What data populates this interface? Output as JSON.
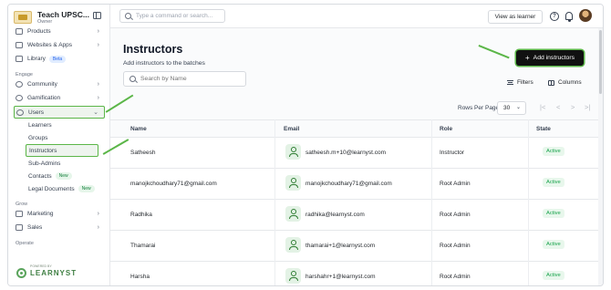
{
  "brand": {
    "name": "Teach UPSC...",
    "role": "Owner"
  },
  "sidebar": {
    "items": [
      {
        "label": "Products",
        "chevron": true
      },
      {
        "label": "Websites & Apps",
        "chevron": true
      },
      {
        "label": "Library",
        "badge": "Beta"
      }
    ],
    "section_engage": "Engage",
    "engage_items": [
      {
        "label": "Community",
        "chevron": true
      },
      {
        "label": "Gamification",
        "chevron": true
      }
    ],
    "users": {
      "label": "Users",
      "chevron": "⌄"
    },
    "users_sub": [
      {
        "label": "Learners"
      },
      {
        "label": "Groups"
      },
      {
        "label": "Instructors",
        "active": true
      },
      {
        "label": "Sub-Admins"
      },
      {
        "label": "Contacts",
        "badge": "New"
      },
      {
        "label": "Legal Documents",
        "badge": "New"
      }
    ],
    "section_grow": "Grow",
    "grow_items": [
      {
        "label": "Marketing",
        "chevron": true
      },
      {
        "label": "Sales",
        "chevron": true
      }
    ],
    "section_operate": "Operate",
    "footer_logo": "LEARNYST",
    "footer_small": "POWERED BY"
  },
  "topbar": {
    "command_placeholder": "Type a command or search...",
    "view_as_learner": "View as learner",
    "help_icon": "question-circle-icon",
    "notifications_icon": "bell-icon"
  },
  "page": {
    "title": "Instructors",
    "subtitle": "Add instructors to the batches",
    "search_placeholder": "Search by Name",
    "add_button": "Add instructors",
    "filters_label": "Filters",
    "columns_label": "Columns",
    "rows_per_page_label": "Rows Per Page",
    "rows_per_page_value": "30",
    "pagination": {
      "first": "|<",
      "prev": "<",
      "next": ">",
      "last": ">|"
    }
  },
  "table": {
    "headers": [
      "Name",
      "Email",
      "Role",
      "State"
    ],
    "rows": [
      {
        "name": "Satheesh",
        "email": "satheesh.m+10@learnyst.com",
        "role": "Instructor",
        "state": "Active"
      },
      {
        "name": "manojkchoudhary71@gmail.com",
        "email": "manojkchoudhary71@gmail.com",
        "role": "Root Admin",
        "state": "Active"
      },
      {
        "name": "Radhika",
        "email": "radhika@learnyst.com",
        "role": "Root Admin",
        "state": "Active"
      },
      {
        "name": "Thamarai",
        "email": "thamarai+1@learnyst.com",
        "role": "Root Admin",
        "state": "Active"
      },
      {
        "name": "Harsha",
        "email": "harshahr+1@learnyst.com",
        "role": "Root Admin",
        "state": "Active"
      }
    ]
  },
  "colors": {
    "accent": "#111111",
    "highlight": "#5bb648",
    "status_active": "#16a34a"
  }
}
